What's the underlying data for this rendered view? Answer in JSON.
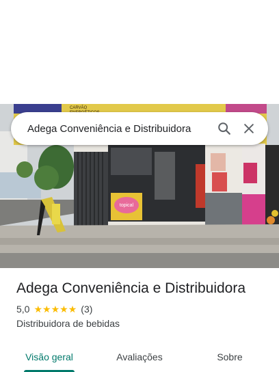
{
  "search": {
    "query": "Adega Conveniência e Distribuidora"
  },
  "place": {
    "title": "Adega Conveniência e Distribuidora",
    "rating": "5,0",
    "stars": 5,
    "review_count": "(3)",
    "category": "Distribuidora de bebidas"
  },
  "tabs": [
    {
      "label": "Visão geral",
      "active": true
    },
    {
      "label": "Avaliações",
      "active": false
    },
    {
      "label": "Sobre",
      "active": false
    }
  ],
  "photo_sign": {
    "banner_text_1": "CARVÃO",
    "banner_text_2": "ENERGÉTICOS",
    "counter_brand": "topical"
  },
  "colors": {
    "accent": "#00796b",
    "star": "#fbbc04",
    "pink_wall": "#d63f8c"
  },
  "icons": [
    "search-icon",
    "close-icon",
    "star-icon"
  ]
}
